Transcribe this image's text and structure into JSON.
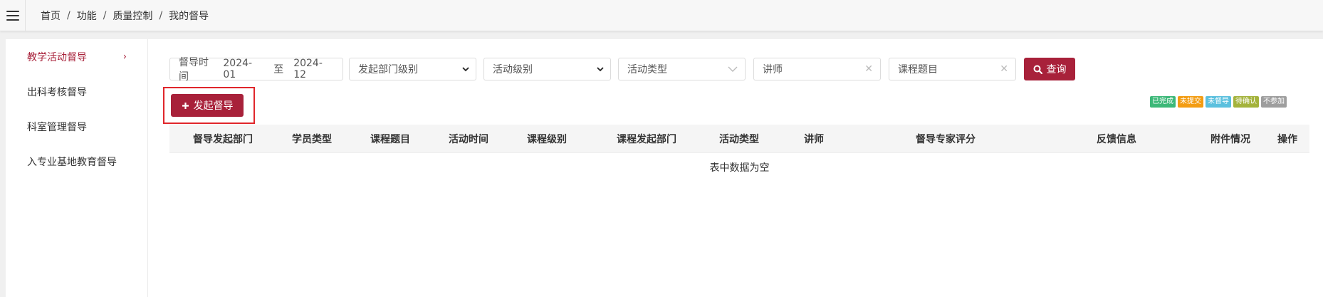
{
  "breadcrumb": [
    "首页",
    "功能",
    "质量控制",
    "我的督导"
  ],
  "sidebar": {
    "items": [
      {
        "label": "教学活动督导",
        "active": true
      },
      {
        "label": "出科考核督导",
        "active": false
      },
      {
        "label": "科室管理督导",
        "active": false
      },
      {
        "label": "入专业基地教育督导",
        "active": false
      }
    ]
  },
  "filters": {
    "date": {
      "label": "督导时间",
      "start": "2024-01",
      "separator": "至",
      "end": "2024-12"
    },
    "dept_level": "发起部门级别",
    "activity_level": "活动级别",
    "activity_type": "活动类型",
    "teacher_placeholder": "讲师",
    "topic_placeholder": "课程题目",
    "search_label": "查询"
  },
  "launch_button": "发起督导",
  "status_badges": [
    {
      "label": "已完成",
      "color": "#3cb878"
    },
    {
      "label": "未提交",
      "color": "#f39c12"
    },
    {
      "label": "未督导",
      "color": "#5bc0de"
    },
    {
      "label": "待确认",
      "color": "#a4b33c"
    },
    {
      "label": "不参加",
      "color": "#9e9e9e"
    }
  ],
  "table": {
    "columns": [
      "督导发起部门",
      "学员类型",
      "课程题目",
      "活动时间",
      "课程级别",
      "课程发起部门",
      "活动类型",
      "讲师",
      "督导专家评分",
      "反馈信息",
      "附件情况",
      "操作"
    ],
    "empty_text": "表中数据为空"
  },
  "colors": {
    "accent": "#a8213a",
    "highlight": "#e0262b"
  }
}
